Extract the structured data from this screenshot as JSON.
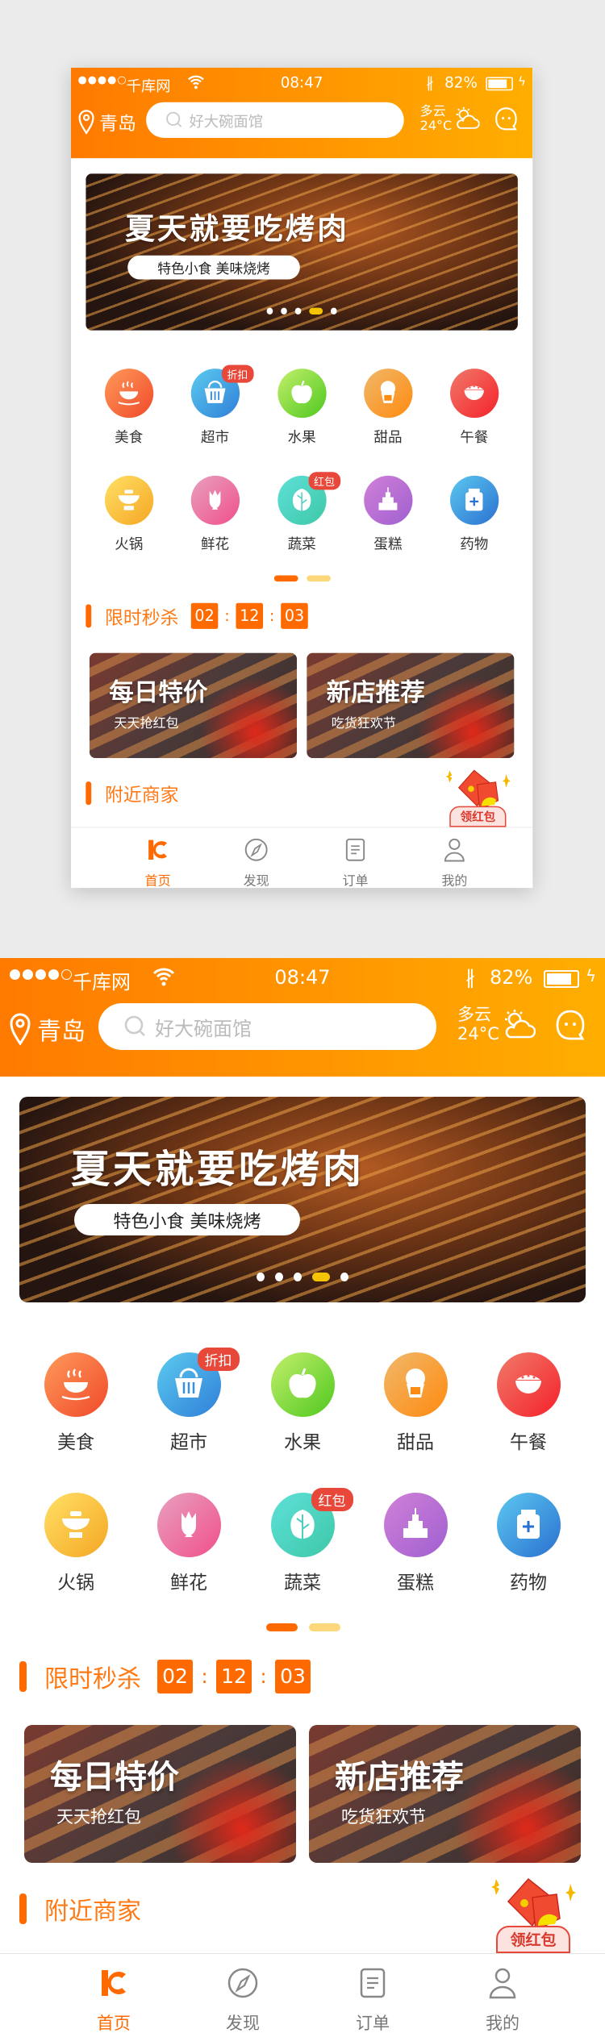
{
  "colors": {
    "accent": "#ff6a00",
    "header_start": "#ff7a00",
    "header_end": "#ffae00",
    "badge": "#e8483a",
    "dot_active": "#f5c400"
  },
  "status_bar": {
    "carrier": "千库网",
    "time": "08:47",
    "battery": "82%",
    "battery_level": 0.82
  },
  "header": {
    "city": "青岛",
    "search_placeholder": "好大碗面馆",
    "weather": "多云",
    "temperature": "24°C"
  },
  "banner": {
    "title": "夏天就要吃烤肉",
    "subtitle": "特色小食  美味烧烤",
    "slides": 5,
    "active_slide": 4
  },
  "categories": [
    {
      "label": "美食",
      "icon": "soup-bowl-icon",
      "color1": "#ff9a5a",
      "color2": "#f0492a"
    },
    {
      "label": "超市",
      "icon": "basket-icon",
      "color1": "#5ccbef",
      "color2": "#2f7fd8",
      "badge": "折扣"
    },
    {
      "label": "水果",
      "icon": "apple-icon",
      "color1": "#c3ef6c",
      "color2": "#4fc81e"
    },
    {
      "label": "甜品",
      "icon": "cupcake-icon",
      "color1": "#f0b86a",
      "color2": "#ff8a10"
    },
    {
      "label": "午餐",
      "icon": "rice-bowl-icon",
      "color1": "#f07a6a",
      "color2": "#f5212a"
    },
    {
      "label": "火锅",
      "icon": "hotpot-icon",
      "color1": "#ffe066",
      "color2": "#f5a623"
    },
    {
      "label": "鲜花",
      "icon": "flower-icon",
      "color1": "#e8a0c0",
      "color2": "#f0508a"
    },
    {
      "label": "蔬菜",
      "icon": "leaf-icon",
      "color1": "#5ee0d8",
      "color2": "#3ec8a8",
      "badge": "红包"
    },
    {
      "label": "蛋糕",
      "icon": "cake-icon",
      "color1": "#d080d8",
      "color2": "#a060d0"
    },
    {
      "label": "药物",
      "icon": "medicine-icon",
      "color1": "#5cc8f0",
      "color2": "#2a70d0"
    }
  ],
  "category_pages": 2,
  "category_active_page": 1,
  "flash_sale": {
    "title": "限时秒杀",
    "hours": "02",
    "minutes": "12",
    "seconds": "03"
  },
  "promos": [
    {
      "title": "每日特价",
      "subtitle": "天天抢红包"
    },
    {
      "title": "新店推荐",
      "subtitle": "吃货狂欢节"
    }
  ],
  "nearby": {
    "title": "附近商家"
  },
  "red_envelope": {
    "label": "领红包"
  },
  "tabs": [
    {
      "label": "首页",
      "icon": "home-logo-icon",
      "active": true
    },
    {
      "label": "发现",
      "icon": "compass-icon"
    },
    {
      "label": "订单",
      "icon": "order-icon"
    },
    {
      "label": "我的",
      "icon": "user-icon"
    }
  ]
}
